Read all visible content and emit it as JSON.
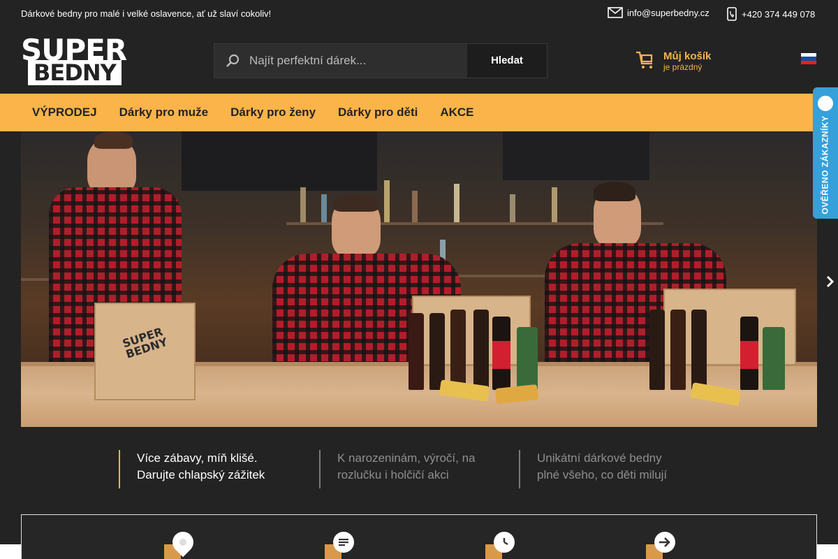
{
  "topbar": {
    "tagline": "Dárkové bedny pro malé i velké oslavence, ať už slaví cokoliv!",
    "email": "info@superbedny.cz",
    "phone": "+420 374 449 078"
  },
  "logo": {
    "line1": "SUPER",
    "line2": "BEDNY"
  },
  "search": {
    "placeholder": "Najít perfektní dárek...",
    "button_label": "Hledat"
  },
  "cart": {
    "title": "Můj košík",
    "status": "je prázdný"
  },
  "nav": {
    "items": [
      {
        "label": "VÝPRODEJ"
      },
      {
        "label": "Dárky pro muže"
      },
      {
        "label": "Dárky pro ženy"
      },
      {
        "label": "Dárky pro děti"
      },
      {
        "label": "AKCE"
      }
    ]
  },
  "verified": {
    "label": "OVĚŘENO ZÁKAZNÍKY"
  },
  "benefits": [
    {
      "line1": "Více zábavy, míň klišé.",
      "line2": "Darujte chlapský zážitek"
    },
    {
      "line1": "K narozeninám, výročí, na",
      "line2": "rozlučku i holčičí akci"
    },
    {
      "line1": "Unikátní dárkové bedny",
      "line2": "plné všeho, co děti milují"
    }
  ],
  "features": [
    {
      "icon": "location-pin-icon"
    },
    {
      "icon": "message-icon"
    },
    {
      "icon": "clock-icon"
    },
    {
      "icon": "arrow-right-icon"
    }
  ],
  "colors": {
    "accent": "#fbb44a",
    "background": "#232323",
    "verified_blue": "#35a0da"
  }
}
